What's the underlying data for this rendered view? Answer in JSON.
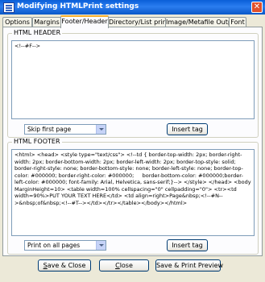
{
  "window": {
    "title": "Modifying HTMLPrint settings",
    "close_glyph": "✕"
  },
  "tabs": [
    {
      "label": "Options"
    },
    {
      "label": "Margins"
    },
    {
      "label": "Footer/Header",
      "active": true
    },
    {
      "label": "Directory/List printing"
    },
    {
      "label": "Image/Metafile Output"
    },
    {
      "label": "Font"
    }
  ],
  "header": {
    "group_title": "HTML HEADER",
    "content": "<!--#F-->",
    "select_value": "Skip first page",
    "insert_tag_label": "Insert tag"
  },
  "footer": {
    "group_title": "HTML FOOTER",
    "content": "<html> <head> <style type=\"text/css\"> <!--td { border-top-width: 2px; border-right-width: 2px; border-bottom-width: 2px; border-left-width: 2px; border-top-style: solid; border-right-style: none; border-bottom-style: none; border-left-style: none; border-top-color: #000000; border-right-color: #000000;     border-bottom-color: #000000;border-left-color: #000000; font-family: Arial, Helvetica, sans-serif;}--> </style> </head> <body MarginHeight=10> <table width=100% cellspacing=\"0\" cellpadding=\"0\"> <tr><td width=90%>PUT YOUR TEXT HERE</td> <td align=right>Page&nbsp;<!--#N-->&nbsp;of&nbsp;<!--#T--></td></tr></table></body></html>",
    "select_value": "Print on all pages",
    "insert_tag_label": "Insert tag"
  },
  "buttons": {
    "save_close": {
      "mnemonic": "S",
      "rest": "ave & Close"
    },
    "close": {
      "mnemonic": "C",
      "rest": "lose"
    },
    "save_preview": {
      "label": "Save & Print Preview"
    }
  },
  "colors": {
    "titlebar": "#0a5fd8",
    "dialog_bg": "#ece9d8",
    "active_tab_accent": "#f8b030"
  }
}
